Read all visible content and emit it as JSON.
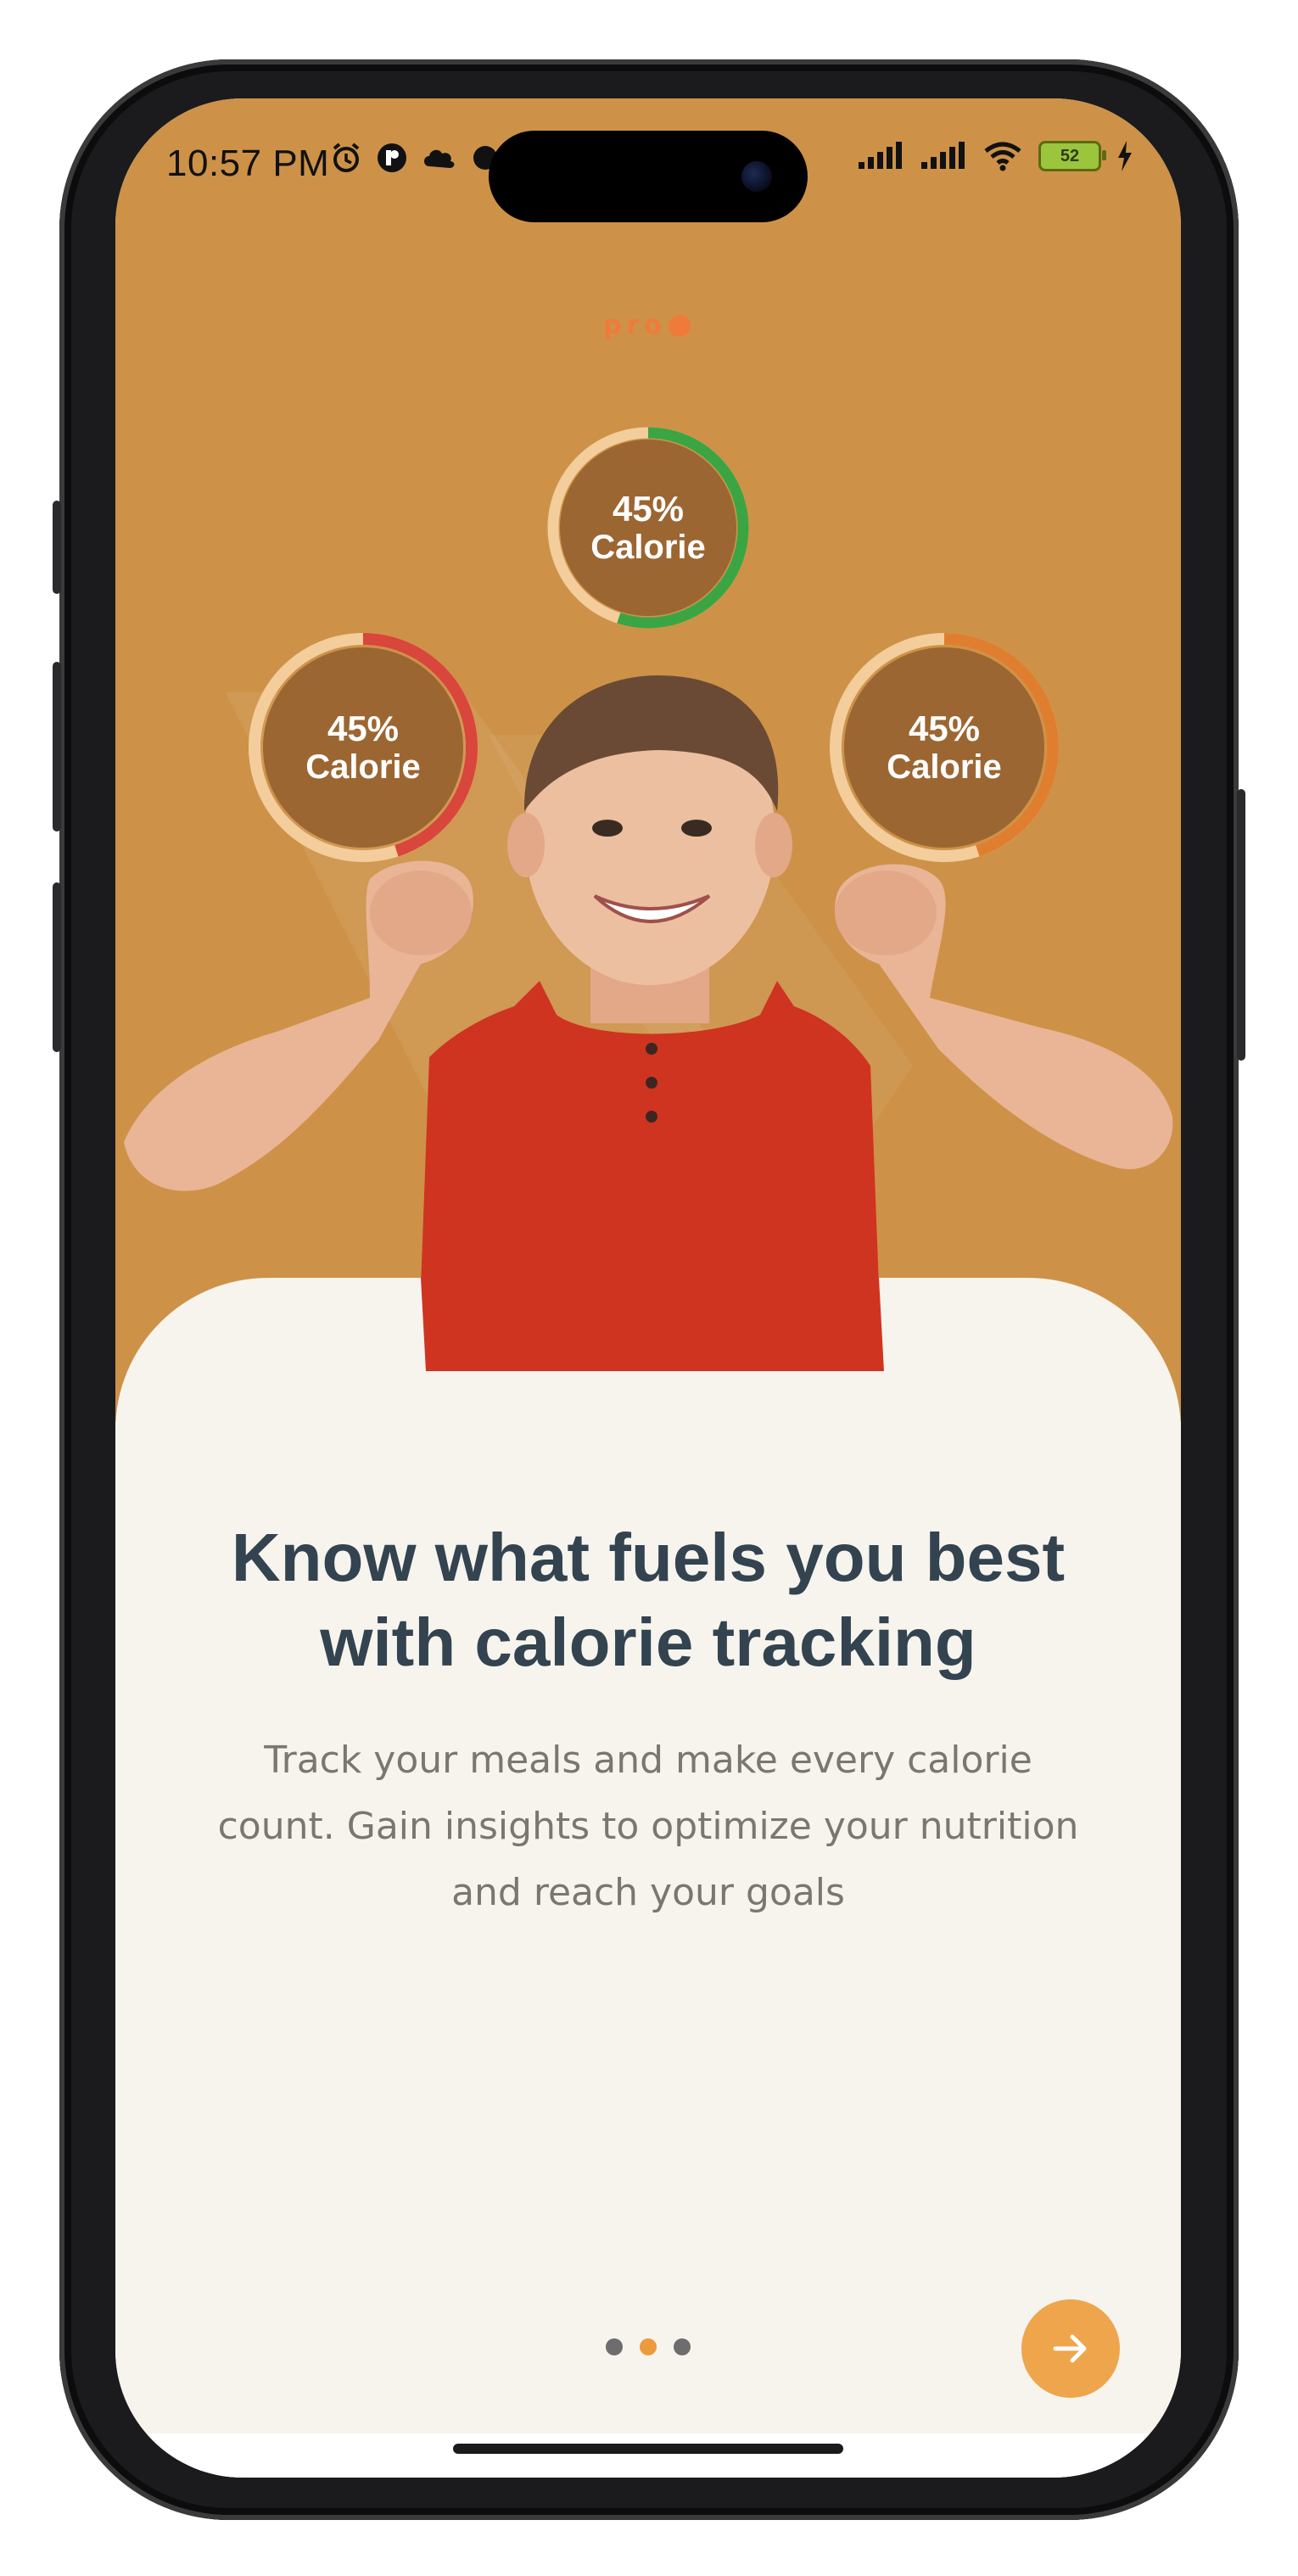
{
  "status_bar": {
    "time": "10:57 PM",
    "left_icons": [
      "alarm-icon",
      "app-badge-icon",
      "cloud-icon",
      "sync-icon"
    ],
    "right_icons": [
      "signal-icon",
      "signal-icon",
      "wifi-icon",
      "battery-icon",
      "charging-icon"
    ],
    "battery_level": "52"
  },
  "brand": {
    "name": "pro"
  },
  "calorie_rings": [
    {
      "percent": "45%",
      "label": "Calorie",
      "fill": 0.45,
      "color": "#d9463b"
    },
    {
      "percent": "45%",
      "label": "Calorie",
      "fill": 0.55,
      "color": "#3ba543"
    },
    {
      "percent": "45%",
      "label": "Calorie",
      "fill": 0.45,
      "color": "#e07e2f"
    }
  ],
  "onboarding": {
    "headline_line1": "Know what fuels you best",
    "headline_line2": "with calorie tracking",
    "description": "Track your meals and make every calorie count. Gain insights to optimize your nutrition and reach your goals",
    "page_current": 2,
    "page_total": 3,
    "next_icon": "arrow-right-icon"
  },
  "colors": {
    "hero_background": "#cd9248",
    "sheet_background": "#f7f4ee",
    "accent": "#efa54b",
    "headline": "#33434f",
    "body_text": "#7a7670"
  }
}
